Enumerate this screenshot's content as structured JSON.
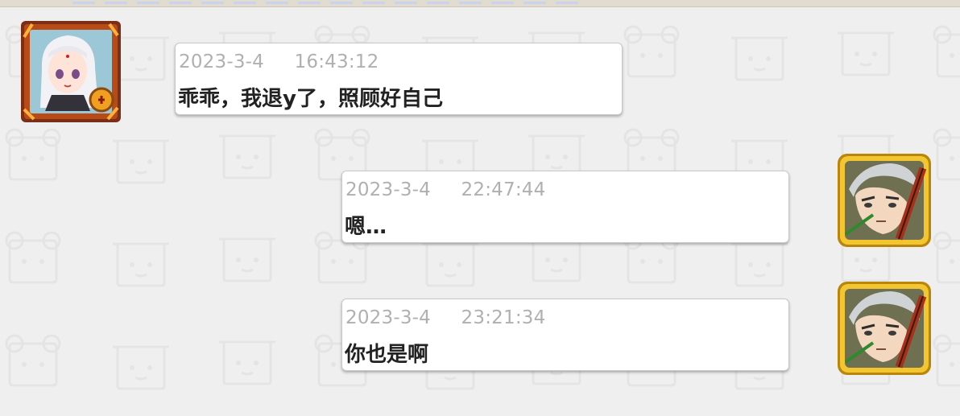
{
  "chat": {
    "messages": [
      {
        "side": "left",
        "sender_avatar": "white-haired-character-avatar",
        "timestamp": "2023-3-4     16:43:12",
        "text": "乖乖，我退y了，照顾好自己"
      },
      {
        "side": "right",
        "sender_avatar": "gray-haired-swordsman-avatar",
        "timestamp": "2023-3-4     22:47:44",
        "text": "嗯…"
      },
      {
        "side": "right",
        "sender_avatar": "gray-haired-swordsman-avatar",
        "timestamp": "2023-3-4     23:21:34",
        "text": "你也是啊"
      }
    ]
  },
  "colors": {
    "background": "#efefef",
    "bubble": "#ffffff",
    "timestamp_text": "#b0b0b0",
    "message_text": "#222222",
    "left_avatar_frame": "#8a3a1c",
    "right_avatar_frame": "#e2b021"
  }
}
